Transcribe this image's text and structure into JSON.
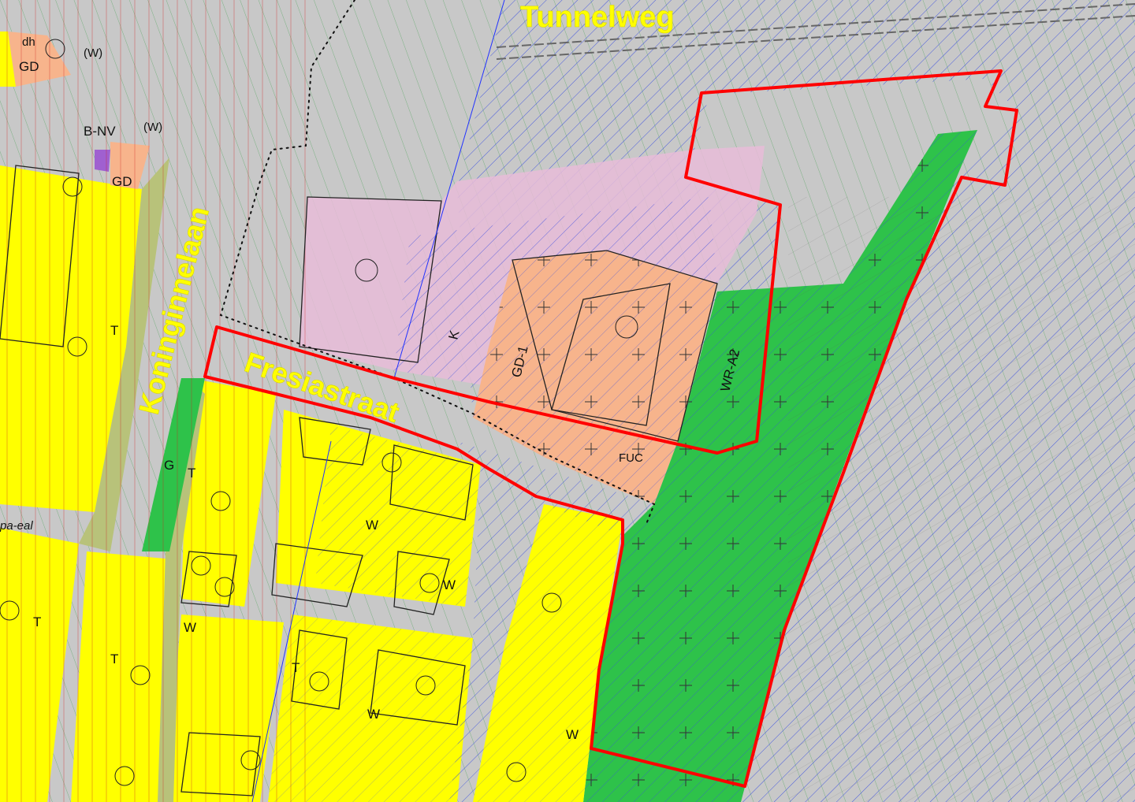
{
  "streets": {
    "tunnelweg": "Tunnelweg",
    "koninginnelaan": "Koninginnelaan",
    "fresiastraat": "Fresiastraat"
  },
  "zone_codes": {
    "gd_top": "GD",
    "gd_mid": "GD",
    "dh": "dh",
    "w_top": "(W)",
    "w_mid": "(W)",
    "bnv": "B-NV",
    "t1": "T",
    "t2": "T",
    "t3": "T",
    "t4": "T",
    "t5": "T",
    "g": "G",
    "w1": "W",
    "w2": "W",
    "w3": "W",
    "w4": "W",
    "w5": "W",
    "k": "K",
    "gd1": "GD-1",
    "wra2": "WR-A2",
    "fuc": "FUC",
    "paeal": "pa-eal"
  },
  "map_colors": {
    "background": "#c8c8c8",
    "residential_yellow": "#ffff00",
    "green_park": "#2ec24a",
    "pink_zone": "#e8bcd8",
    "orange_zone": "#f7b48c",
    "olive_strip": "#b8c27a",
    "blue_hatch": "#3a4ee0",
    "boundary_red": "#ff0000"
  }
}
